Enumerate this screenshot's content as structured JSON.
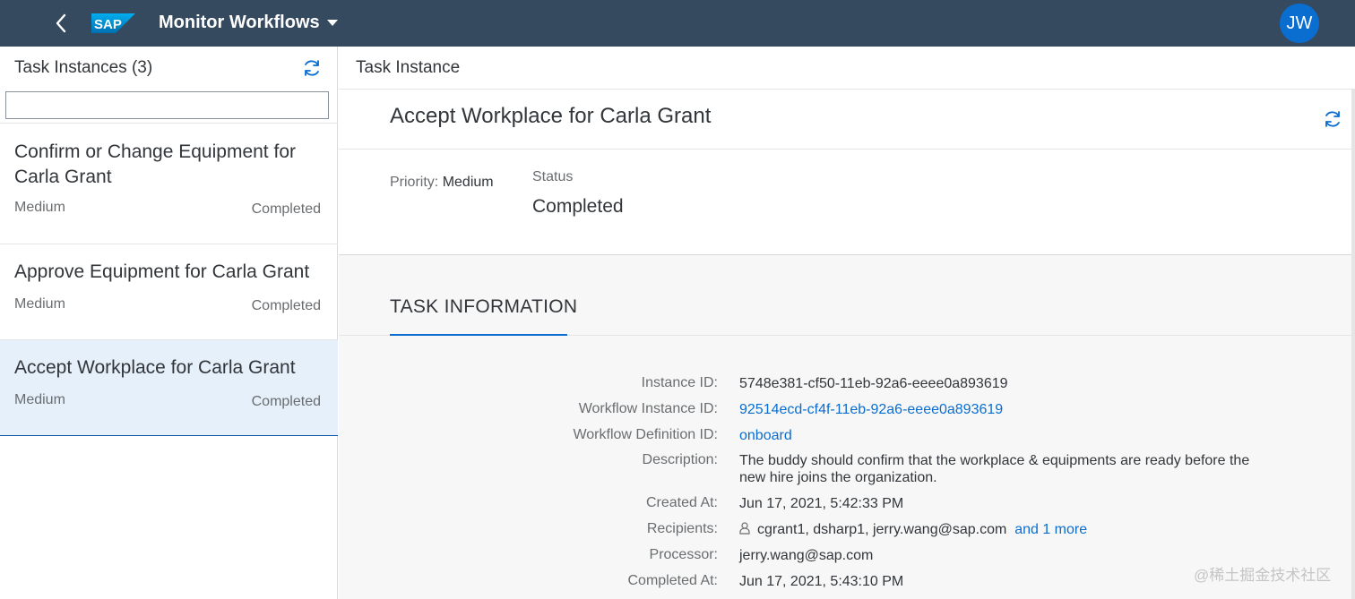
{
  "shell": {
    "logo_text": "SAP",
    "title": "Monitor Workflows",
    "avatar_initials": "JW",
    "colors": {
      "bar": "#354a5f",
      "avatar": "#0a6ed1"
    }
  },
  "master": {
    "title": "Task Instances (3)",
    "search_value": "",
    "items": [
      {
        "title": "Confirm or Change Equipment for Carla Grant",
        "priority": "Medium",
        "status": "Completed"
      },
      {
        "title": "Approve Equipment for Carla Grant",
        "priority": "Medium",
        "status": "Completed"
      },
      {
        "title": "Accept Workplace for Carla Grant",
        "priority": "Medium",
        "status": "Completed",
        "selected": true
      }
    ]
  },
  "detail": {
    "header_title": "Task Instance",
    "object_title": "Accept Workplace for Carla Grant",
    "priority_label": "Priority:",
    "priority_value": "Medium",
    "status_label": "Status",
    "status_value": "Completed",
    "section_title": "TASK INFORMATION",
    "fields": {
      "instance_id": {
        "label": "Instance ID:",
        "value": "5748e381-cf50-11eb-92a6-eeee0a893619"
      },
      "workflow_instance_id": {
        "label": "Workflow Instance ID:",
        "value": "92514ecd-cf4f-11eb-92a6-eeee0a893619"
      },
      "workflow_definition_id": {
        "label": "Workflow Definition ID:",
        "value": "onboard"
      },
      "description": {
        "label": "Description:",
        "value": "The buddy should confirm that the workplace & equipments are ready before the new hire joins the organization."
      },
      "created_at": {
        "label": "Created At:",
        "value": "Jun 17, 2021, 5:42:33 PM"
      },
      "recipients": {
        "label": "Recipients:",
        "value": "cgrant1, dsharp1, jerry.wang@sap.com",
        "more_link": "and 1 more"
      },
      "processor": {
        "label": "Processor:",
        "value": "jerry.wang@sap.com"
      },
      "completed_at": {
        "label": "Completed At:",
        "value": "Jun 17, 2021, 5:43:10 PM"
      }
    }
  },
  "watermark": "@稀土掘金技术社区",
  "icons": [
    "back-icon",
    "refresh-icon",
    "person-icon",
    "chevron-down-icon"
  ]
}
